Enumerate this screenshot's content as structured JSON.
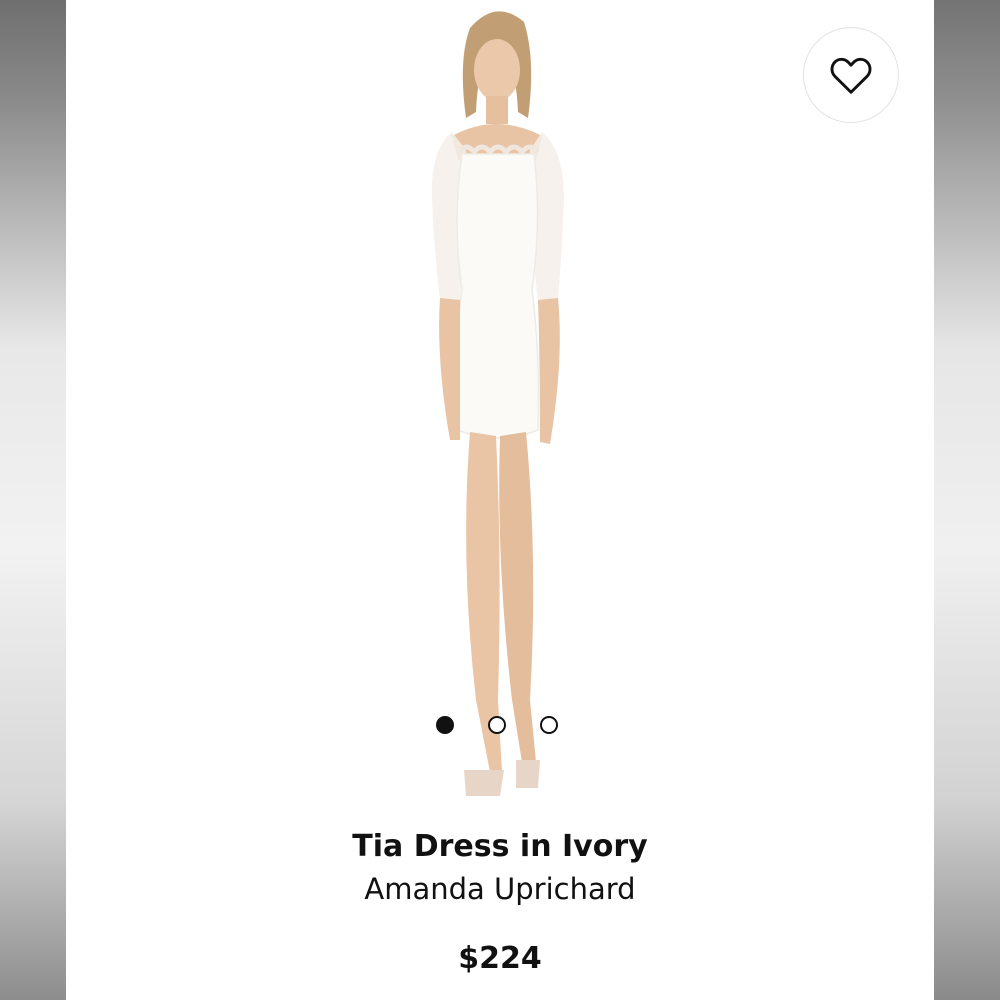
{
  "product": {
    "title": "Tia Dress in Ivory",
    "brand": "Amanda Uprichard",
    "price": "$224"
  },
  "favorite": {
    "icon": "heart-outline-icon"
  },
  "carousel": {
    "total_images": 3,
    "active_index": 0
  },
  "colors": {
    "text": "#111111",
    "dress": "#fbfaf7",
    "skin": "#e7c3a6",
    "hair": "#b9946c"
  }
}
